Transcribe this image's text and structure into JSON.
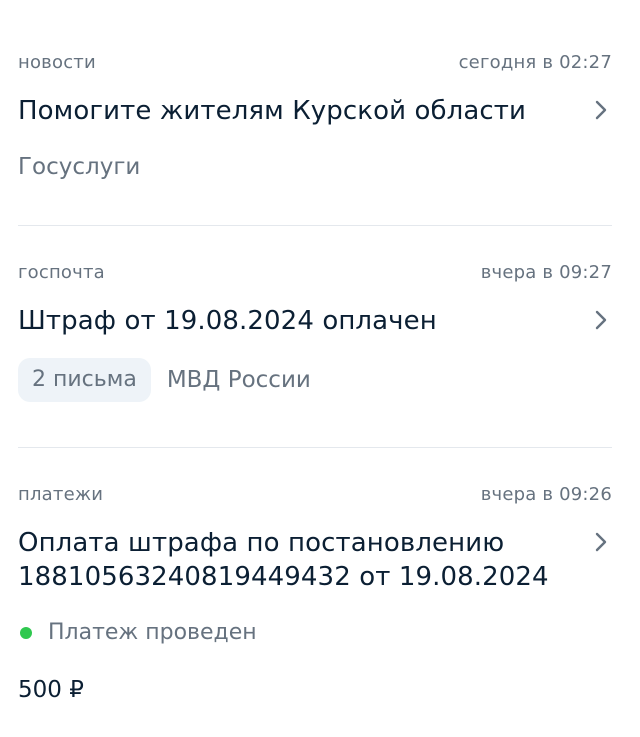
{
  "notifications": [
    {
      "category": "новости",
      "time": "сегодня в 02:27",
      "title": "Помогите жителям Курской области",
      "source": "Госуслуги"
    },
    {
      "category": "госпочта",
      "time": "вчера в 09:27",
      "title": "Штраф от 19.08.2024 оплачен",
      "badge": "2 письма",
      "source": "МВД России"
    },
    {
      "category": "платежи",
      "time": "вчера в 09:26",
      "title_line1": "Оплата штрафа по постановлению",
      "title_line2": "18810563240819449432 от 19.08.2024",
      "status": "Платеж проведен",
      "status_color": "#2fc84f",
      "amount": "500 ₽"
    }
  ],
  "colors": {
    "text_primary": "#0b1f33",
    "text_secondary": "#66727f",
    "pill_background": "#eef3f8",
    "divider": "#e4e8ed"
  },
  "icons": {
    "chevron": "chevron-right-icon"
  }
}
